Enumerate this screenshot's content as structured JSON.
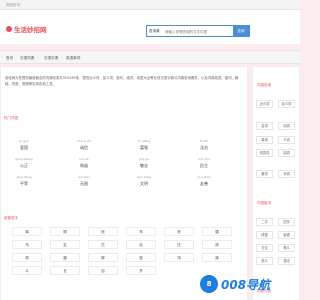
{
  "topbar": {
    "text": "阅信好词"
  },
  "logo": {
    "text": "生活妙招网"
  },
  "search": {
    "select_label": "查词典",
    "placeholder": "请输入你想查询的汉字词语",
    "button": "查询"
  },
  "nav": {
    "items": [
      "首页",
      "汉语词典",
      "汉语字典",
      "英语单词"
    ]
  },
  "intro": "阅信网为您提供最新最全的词典收录共355438条，提供近义词、反义词、造句、组词、成语大全等在线汉语字典与词典查询服务，以及词典成语、组词、解释、拼音、笔顺等实用查询工具。",
  "hot_title": "热门词语",
  "hot_words": [
    {
      "py": "ài guó",
      "hz": "爱国"
    },
    {
      "py": "chéng xìn",
      "hz": "诚信"
    },
    {
      "py": "fù qiáng",
      "hz": "富强"
    },
    {
      "py": "fǎ zhì",
      "hz": "法治"
    },
    {
      "py": "gōng zhèng",
      "hz": "公正"
    },
    {
      "py": "hé xié",
      "hz": "和谐"
    },
    {
      "py": "jìng yè",
      "hz": "敬业"
    },
    {
      "py": "mín zhǔ",
      "hz": "民主"
    },
    {
      "py": "píng děng",
      "hz": "平等"
    },
    {
      "py": "wú xiàn",
      "hz": "无限"
    },
    {
      "py": "wén míng",
      "hz": "文明"
    },
    {
      "py": "yǒu shàn",
      "hz": "友善"
    }
  ],
  "radical_title": "部首查字",
  "radicals": [
    [
      "粤",
      "丽",
      "班",
      "车",
      "夹",
      "唐"
    ],
    [
      "乌",
      "定",
      "忆",
      "巨",
      "庄",
      "祥"
    ],
    [
      "胡",
      "避",
      "厚",
      "竖",
      "鸿",
      "辉"
    ],
    [
      "斗",
      "长",
      "自",
      "开",
      "",
      ""
    ]
  ],
  "sidebar": {
    "section1_title": "词语查询",
    "section1_buttons": [
      "近义词",
      "反义词",
      "名词",
      "动词",
      "量词",
      "介词",
      "形容词",
      "副词",
      "数词",
      "代词"
    ],
    "section2_title": "词语组词",
    "section2_buttons": [
      "二字",
      "四字",
      "成语",
      "俗语",
      "方位",
      "褒义",
      "贬义",
      "语法"
    ],
    "section3_title": "词语分类"
  },
  "watermark": {
    "logo": "8",
    "text": "008导航"
  }
}
